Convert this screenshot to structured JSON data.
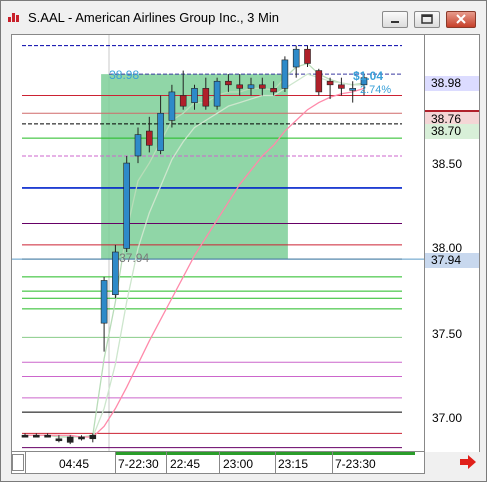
{
  "window": {
    "title": "S.AAL - American Airlines Group Inc., 3 Min",
    "icons": {
      "app": "chart-app-icon",
      "minimize": "minimize-icon",
      "maximize": "maximize-icon",
      "close": "close-icon",
      "scroll": "scroll-right-arrow-icon"
    }
  },
  "price_axis": {
    "ticks": [
      "38.50",
      "38.00",
      "37.50",
      "37.00"
    ],
    "current_tag": "38.98",
    "level_tag_1": "38.76",
    "level_tag_2": "38.70",
    "low_tag": "37.94"
  },
  "time_axis": {
    "labels": [
      "04:45",
      "7-22:30",
      "22:45",
      "23:00",
      "23:15",
      "7-23:30"
    ]
  },
  "overlay_labels": {
    "rect_top": "38.98",
    "rect_bottom": "37.94",
    "profit": "$1.04",
    "pct": "2.74%"
  },
  "colors": {
    "rect_fill": "#7ccf98",
    "up_candle": "#2e8ac9",
    "down_candle": "#b0202a",
    "current_tag_bg": "#dcdcff",
    "low_tag_bg": "#c8d8ee",
    "accent_text": "#3aa0d8"
  },
  "chart_data": {
    "type": "candlestick",
    "symbol": "S.AAL",
    "interval": "3 Min",
    "ylim": [
      36.85,
      39.2
    ],
    "x": [
      "04:45",
      "7-22:30",
      "22:45",
      "23:00",
      "23:15",
      "7-23:30"
    ],
    "candles": [
      {
        "o": 36.95,
        "h": 36.96,
        "l": 36.94,
        "c": 36.95
      },
      {
        "o": 36.95,
        "h": 36.96,
        "l": 36.94,
        "c": 36.95
      },
      {
        "o": 36.95,
        "h": 36.96,
        "l": 36.94,
        "c": 36.95
      },
      {
        "o": 36.93,
        "h": 36.95,
        "l": 36.91,
        "c": 36.92
      },
      {
        "o": 36.91,
        "h": 36.95,
        "l": 36.9,
        "c": 36.94
      },
      {
        "o": 36.94,
        "h": 36.95,
        "l": 36.92,
        "c": 36.93
      },
      {
        "o": 36.93,
        "h": 36.96,
        "l": 36.91,
        "c": 36.95
      },
      {
        "o": 37.58,
        "h": 37.84,
        "l": 37.42,
        "c": 37.82
      },
      {
        "o": 37.74,
        "h": 38.02,
        "l": 37.72,
        "c": 37.98
      },
      {
        "o": 38.0,
        "h": 38.52,
        "l": 37.98,
        "c": 38.48
      },
      {
        "o": 38.52,
        "h": 38.68,
        "l": 38.48,
        "c": 38.64
      },
      {
        "o": 38.66,
        "h": 38.74,
        "l": 38.54,
        "c": 38.58
      },
      {
        "o": 38.55,
        "h": 38.86,
        "l": 38.53,
        "c": 38.76
      },
      {
        "o": 38.72,
        "h": 38.92,
        "l": 38.68,
        "c": 38.88
      },
      {
        "o": 38.86,
        "h": 39.0,
        "l": 38.78,
        "c": 38.8
      },
      {
        "o": 38.82,
        "h": 38.92,
        "l": 38.78,
        "c": 38.9
      },
      {
        "o": 38.9,
        "h": 38.96,
        "l": 38.78,
        "c": 38.8
      },
      {
        "o": 38.8,
        "h": 38.96,
        "l": 38.78,
        "c": 38.94
      },
      {
        "o": 38.94,
        "h": 38.98,
        "l": 38.88,
        "c": 38.92
      },
      {
        "o": 38.92,
        "h": 38.98,
        "l": 38.86,
        "c": 38.9
      },
      {
        "o": 38.9,
        "h": 38.96,
        "l": 38.86,
        "c": 38.92
      },
      {
        "o": 38.92,
        "h": 38.96,
        "l": 38.86,
        "c": 38.9
      },
      {
        "o": 38.9,
        "h": 38.94,
        "l": 38.86,
        "c": 38.88
      },
      {
        "o": 38.9,
        "h": 39.08,
        "l": 38.88,
        "c": 39.06
      },
      {
        "o": 39.02,
        "h": 39.14,
        "l": 38.96,
        "c": 39.12
      },
      {
        "o": 39.12,
        "h": 39.14,
        "l": 39.02,
        "c": 39.04
      },
      {
        "o": 39.0,
        "h": 39.01,
        "l": 38.86,
        "c": 38.88
      },
      {
        "o": 38.94,
        "h": 38.96,
        "l": 38.84,
        "c": 38.92
      },
      {
        "o": 38.92,
        "h": 38.96,
        "l": 38.86,
        "c": 38.9
      },
      {
        "o": 38.9,
        "h": 38.94,
        "l": 38.82,
        "c": 38.9
      },
      {
        "o": 38.92,
        "h": 38.98,
        "l": 38.86,
        "c": 38.96
      }
    ],
    "horizontal_levels": [
      {
        "price": 39.14,
        "color": "#0000aa",
        "style": "dash"
      },
      {
        "price": 38.98,
        "color": "#3a3aa0",
        "style": "dash"
      },
      {
        "price": 38.86,
        "color": "#cc2233",
        "style": "solid"
      },
      {
        "price": 38.76,
        "color": "#d06a6a",
        "style": "solid"
      },
      {
        "price": 38.7,
        "color": "#000000",
        "style": "dash"
      },
      {
        "price": 38.62,
        "color": "#22bb22",
        "style": "solid"
      },
      {
        "price": 38.52,
        "color": "#cc66cc",
        "style": "dash"
      },
      {
        "price": 38.34,
        "color": "#0022cc",
        "style": "solid"
      },
      {
        "price": 38.14,
        "color": "#660066",
        "style": "solid"
      },
      {
        "price": 38.02,
        "color": "#cc2233",
        "style": "solid"
      },
      {
        "price": 37.94,
        "color": "#000000",
        "style": "solid"
      },
      {
        "price": 37.84,
        "color": "#22bb22",
        "style": "solid"
      },
      {
        "price": 37.76,
        "color": "#22bb22",
        "style": "solid"
      },
      {
        "price": 37.72,
        "color": "#22bb22",
        "style": "solid"
      },
      {
        "price": 37.66,
        "color": "#22bb22",
        "style": "solid"
      },
      {
        "price": 37.5,
        "color": "#88cc88",
        "style": "solid"
      },
      {
        "price": 37.36,
        "color": "#cc66cc",
        "style": "solid"
      },
      {
        "price": 37.28,
        "color": "#cc66cc",
        "style": "solid"
      },
      {
        "price": 37.16,
        "color": "#cc66cc",
        "style": "solid"
      },
      {
        "price": 37.08,
        "color": "#000000",
        "style": "solid"
      },
      {
        "price": 36.96,
        "color": "#cc2233",
        "style": "solid"
      },
      {
        "price": 36.88,
        "color": "#660066",
        "style": "solid"
      }
    ],
    "rectangle": {
      "from_bar": 7,
      "to_bar": 23,
      "top": 38.98,
      "bottom": 37.94
    },
    "crosshair_price": 37.94,
    "moving_averages": [
      {
        "color": "#b8dcb8",
        "values": [
          36.95,
          36.95,
          36.95,
          36.94,
          36.94,
          36.94,
          36.95,
          37.38,
          37.7,
          38.1,
          38.38,
          38.48,
          38.6,
          38.72,
          38.76,
          38.82,
          38.82,
          38.86,
          38.88,
          38.88,
          38.9,
          38.9,
          38.89,
          38.96,
          39.02,
          39.04,
          38.98,
          38.95,
          38.93,
          38.92,
          38.93
        ]
      },
      {
        "color": "#cde6cd",
        "values": [
          36.95,
          36.95,
          36.95,
          36.95,
          36.94,
          36.94,
          36.94,
          37.1,
          37.35,
          37.7,
          38.0,
          38.2,
          38.35,
          38.5,
          38.6,
          38.68,
          38.72,
          38.76,
          38.8,
          38.82,
          38.84,
          38.86,
          38.86,
          38.9,
          38.94,
          38.98,
          38.96,
          38.94,
          38.93,
          38.92,
          38.92
        ]
      },
      {
        "color": "#ff8aaa",
        "values": [
          36.95,
          36.95,
          36.95,
          36.95,
          36.95,
          36.94,
          36.94,
          37.0,
          37.1,
          37.22,
          37.35,
          37.48,
          37.6,
          37.72,
          37.84,
          37.96,
          38.06,
          38.16,
          38.26,
          38.36,
          38.44,
          38.52,
          38.58,
          38.66,
          38.72,
          38.78,
          38.82,
          38.85,
          38.87,
          38.88,
          38.9
        ]
      }
    ]
  }
}
